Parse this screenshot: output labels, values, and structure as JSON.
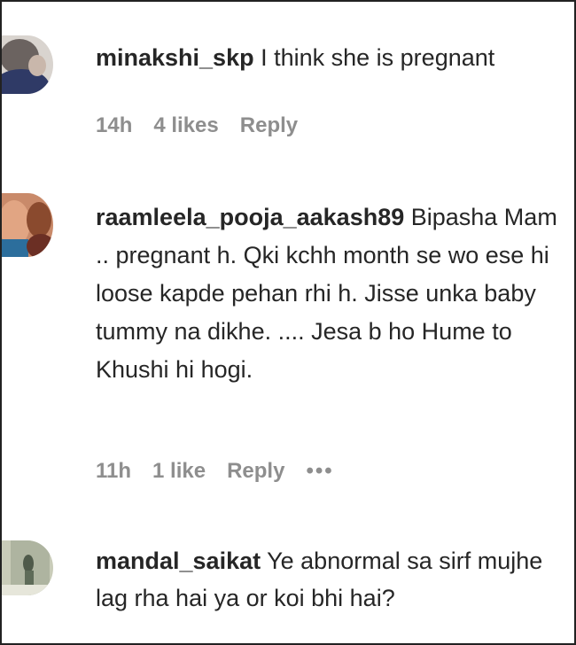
{
  "comments": [
    {
      "username": "minakshi_skp",
      "text": " I think she is pregnant",
      "time": "14h",
      "likes": "4 likes",
      "reply": "Reply"
    },
    {
      "username": "raamleela_pooja_aakash89",
      "text": " Bipasha Mam .. pregnant h. Qki kchh month se wo ese hi loose kapde pehan rhi h. Jisse unka baby tummy na dikhe. .... Jesa b ho Hume to Khushi hi hogi.",
      "time": "11h",
      "likes": "1 like",
      "reply": "Reply",
      "more": "•••"
    },
    {
      "username": "mandal_saikat",
      "text": " Ye abnormal sa sirf mujhe lag rha hai ya or koi bhi hai?"
    }
  ],
  "colors": {
    "text": "#262626",
    "meta": "#8e8e8e"
  }
}
